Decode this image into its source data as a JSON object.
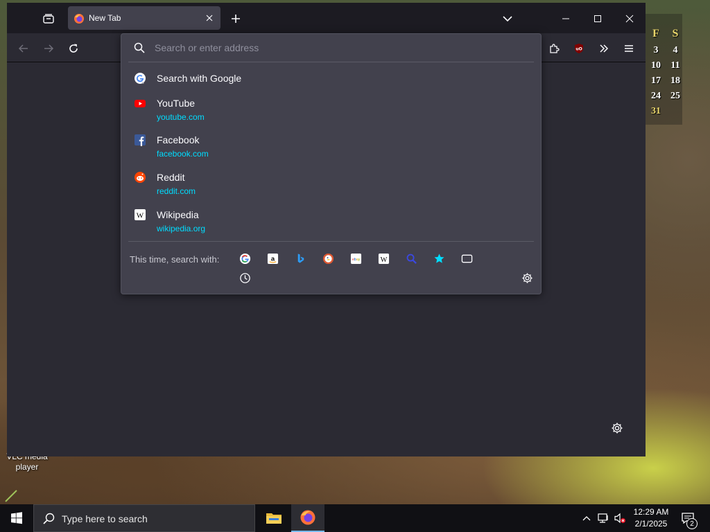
{
  "browser": {
    "tab": {
      "title": "New Tab"
    }
  },
  "urlbar": {
    "placeholder": "Search or enter address",
    "search_row": {
      "title": "Search with Google"
    },
    "results": [
      {
        "title": "YouTube",
        "url": "youtube.com",
        "icon": "youtube-icon"
      },
      {
        "title": "Facebook",
        "url": "facebook.com",
        "icon": "facebook-icon"
      },
      {
        "title": "Reddit",
        "url": "reddit.com",
        "icon": "reddit-icon"
      },
      {
        "title": "Wikipedia",
        "url": "wikipedia.org",
        "icon": "wikipedia-icon"
      }
    ],
    "oneoff_label": "This time, search with:",
    "oneoff_engines": [
      "google-icon",
      "amazon-icon",
      "bing-icon",
      "duckduckgo-icon",
      "ebay-icon",
      "wikipedia-icon",
      "search-icon",
      "bookmarks-star-icon",
      "tabs-icon",
      "history-icon"
    ]
  },
  "desktop": {
    "vlc_label": "VLC media player",
    "calendar": {
      "headers": [
        "F",
        "S"
      ],
      "rows": [
        [
          "3",
          "4"
        ],
        [
          "10",
          "11"
        ],
        [
          "17",
          "18"
        ],
        [
          "24",
          "25"
        ],
        [
          "31",
          ""
        ]
      ]
    }
  },
  "taskbar": {
    "search_placeholder": "Type here to search",
    "time": "12:29 AM",
    "date": "2/1/2025",
    "notification_count": "2"
  },
  "colors": {
    "accent_url": "#00ddff",
    "panel_bg": "#42414d",
    "chrome_bg": "#1c1b22"
  }
}
